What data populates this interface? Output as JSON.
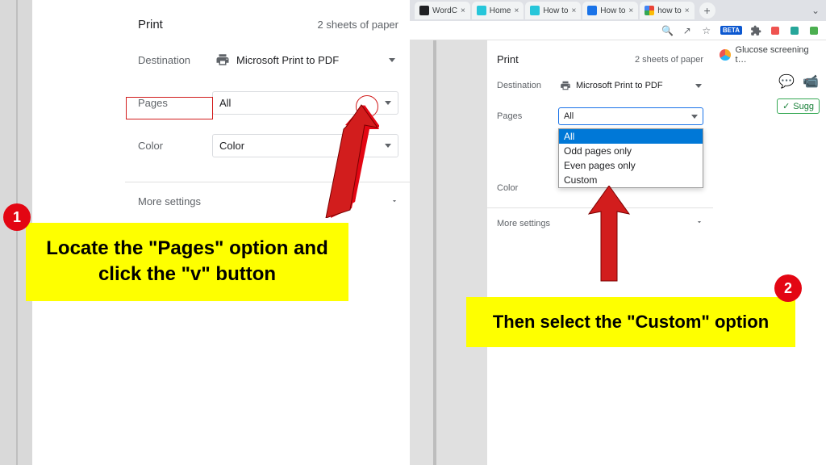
{
  "left_panel": {
    "title": "Print",
    "sheets": "2 sheets of paper",
    "destination_label": "Destination",
    "destination_value": "Microsoft Print to PDF",
    "pages_label": "Pages",
    "pages_value": "All",
    "color_label": "Color",
    "color_value": "Color",
    "more_settings": "More settings"
  },
  "right_panel": {
    "title": "Print",
    "sheets": "2 sheets of paper",
    "destination_label": "Destination",
    "destination_value": "Microsoft Print to PDF",
    "pages_label": "Pages",
    "pages_value": "All",
    "color_label": "Color",
    "more_settings": "More settings",
    "dropdown": {
      "opt1": "All",
      "opt2": "Odd pages only",
      "opt3": "Even pages only",
      "opt4": "Custom"
    }
  },
  "callouts": {
    "step1_num": "1",
    "step1_text": "Locate the \"Pages\" option and click the \"v\" button",
    "step2_num": "2",
    "step2_text": "Then select the \"Custom\" option"
  },
  "tabs": {
    "t1": "WordC",
    "t2": "Home",
    "t3": "How to",
    "t4": "How to",
    "t5": "how to"
  },
  "toolbar": {
    "beta": "BETA"
  },
  "ext": {
    "glucose": "Glucose screening t…",
    "sugg": "Sugg"
  }
}
